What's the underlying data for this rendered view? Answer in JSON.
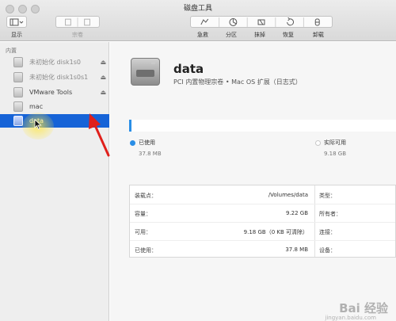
{
  "window": {
    "title": "磁盘工具"
  },
  "toolbar": {
    "view_label": "显示",
    "volume_label": "宗卷",
    "first_aid_label": "急救",
    "partition_label": "分区",
    "erase_label": "抹掉",
    "restore_label": "恢复",
    "unmount_label": "卸载"
  },
  "sidebar": {
    "header": "内置",
    "items": [
      {
        "label": "未初始化 disk1s0",
        "icon": "disk-icon",
        "eject": "⏏"
      },
      {
        "label": "未初始化 disk1s0s1",
        "icon": "disk-icon",
        "eject": "⏏"
      },
      {
        "label": "VMware Tools",
        "icon": "disk-icon",
        "eject": "⏏"
      },
      {
        "label": "mac",
        "icon": "disk-icon"
      },
      {
        "label": "data",
        "icon": "disk-icon",
        "selected": true
      }
    ]
  },
  "volume": {
    "name": "data",
    "description": "PCI 内置物理宗卷 • Mac OS 扩展（日志式）"
  },
  "usage": {
    "used_title": "已使用",
    "used_value": "37.8 MB",
    "available_title": "实际可用",
    "available_value": "9.18 GB",
    "used_color": "#2a8ee6",
    "available_color": "#ffffff"
  },
  "info": {
    "mount_point_key": "装载点：",
    "mount_point_value": "/Volumes/data",
    "capacity_key": "容量：",
    "capacity_value": "9.22 GB",
    "available_key": "可用：",
    "available_value": "9.18 GB（0 KB 可清除）",
    "used_key": "已使用：",
    "used_value": "37.8 MB",
    "type_key": "类型：",
    "owners_key": "所有者：",
    "connection_key": "连接：",
    "device_key": "设备："
  },
  "watermark": {
    "text": "Bai 经验",
    "sub": "jingyan.baidu.com"
  },
  "colors": {
    "selection": "#1663d7",
    "arrow": "#e0201b"
  }
}
